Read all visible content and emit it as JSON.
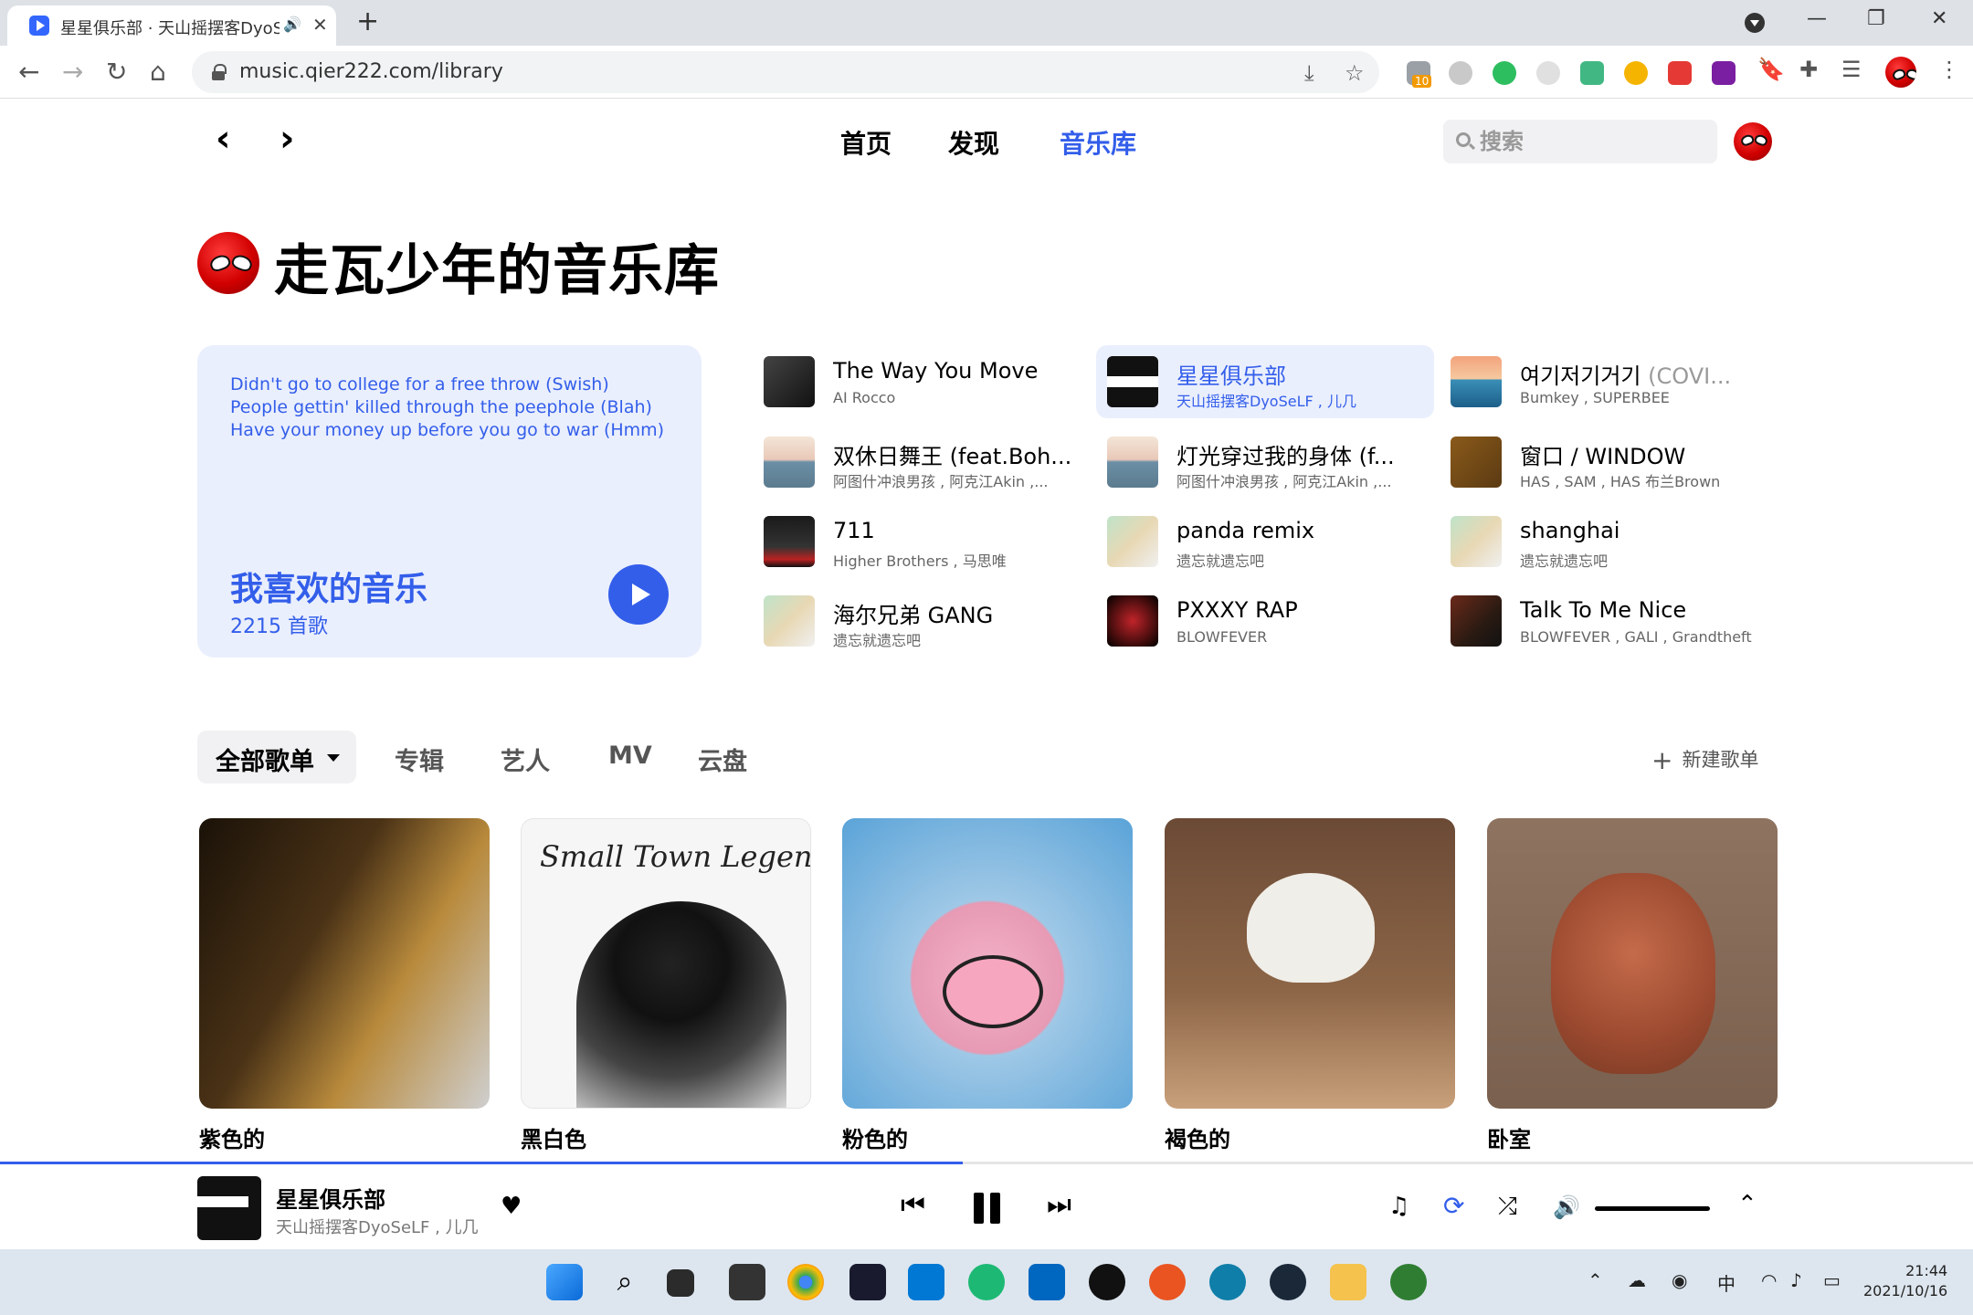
{
  "browser": {
    "tab_title": "星星俱乐部 · 天山摇摆客DyoSeLF, 儿几",
    "url": "music.qier222.com/library",
    "new_tab": "+",
    "tab_close": "✕",
    "audio_icon": "speaker-icon",
    "ext_badge": "10",
    "win_min": "—",
    "win_restore": "❐",
    "win_close": "✕"
  },
  "nav": {
    "back": "‹",
    "forward": "›",
    "items": [
      {
        "label": "首页"
      },
      {
        "label": "发现"
      },
      {
        "label": "音乐库"
      }
    ],
    "active_index": 2,
    "search_placeholder": "搜索"
  },
  "page": {
    "title": "走瓦少年的音乐库"
  },
  "liked": {
    "lyrics": [
      "Didn't go to college for a free throw (Swish)",
      "People gettin' killed through the peephole (Blah)",
      "Have your money up before you go to war (Hmm)"
    ],
    "title": "我喜欢的音乐",
    "count": "2215 首歌"
  },
  "songs": [
    {
      "title": "The Way You Move",
      "sub": "",
      "artist": "AI Rocco",
      "cover": "c-dark"
    },
    {
      "title": "星星俱乐部",
      "sub": "",
      "artist": "天山摇摆客DyoSeLF , 儿几",
      "cover": "c-band",
      "active": true
    },
    {
      "title": "여기저기거기",
      "sub": "(COVI...",
      "artist": "Bumkey , SUPERBEE",
      "cover": "c-sunset"
    },
    {
      "title": "双休日舞王 (feat.Boh...",
      "sub": "",
      "artist": "阿图什冲浪男孩 , 阿克江Akin ,...",
      "cover": "c-sea"
    },
    {
      "title": "灯光穿过我的身体 (f...",
      "sub": "",
      "artist": "阿图什冲浪男孩 , 阿克江Akin ,...",
      "cover": "c-sea"
    },
    {
      "title": "窗口 / WINDOW",
      "sub": "",
      "artist": "HAS , SAM , HAS 布兰Brown",
      "cover": "c-gold"
    },
    {
      "title": "711",
      "sub": "",
      "artist": "Higher Brothers , 马思唯",
      "cover": "c-night"
    },
    {
      "title": "panda remix",
      "sub": "",
      "artist": "遗忘就遗忘吧",
      "cover": "c-cartoon"
    },
    {
      "title": "shanghai",
      "sub": "",
      "artist": "遗忘就遗忘吧",
      "cover": "c-cartoon"
    },
    {
      "title": "海尔兄弟 GANG",
      "sub": "",
      "artist": "遗忘就遗忘吧",
      "cover": "c-cartoon"
    },
    {
      "title": "PXXXY RAP",
      "sub": "",
      "artist": "BLOWFEVER",
      "cover": "c-red"
    },
    {
      "title": "Talk To Me Nice",
      "sub": "",
      "artist": "BLOWFEVER , GALI , Grandtheft",
      "cover": "c-talk"
    }
  ],
  "tabs": [
    {
      "label": "全部歌单"
    },
    {
      "label": "专辑"
    },
    {
      "label": "艺人"
    },
    {
      "label": "MV"
    },
    {
      "label": "云盘"
    }
  ],
  "new_playlist": "新建歌单",
  "playlists": [
    {
      "name": "紫色的"
    },
    {
      "name": "黑白色",
      "cover_text": "Small Town Legend"
    },
    {
      "name": "粉色的"
    },
    {
      "name": "褐色的"
    },
    {
      "name": "卧室"
    }
  ],
  "player": {
    "title": "星星俱乐部",
    "artist": "天山摇摆客DyoSeLF , 儿几",
    "progress": 0.488
  },
  "taskbar": {
    "time": "21:44",
    "date": "2021/10/16",
    "ime": "中"
  },
  "colors": {
    "accent": "#335eea",
    "accent_bg": "#eaeffd"
  }
}
